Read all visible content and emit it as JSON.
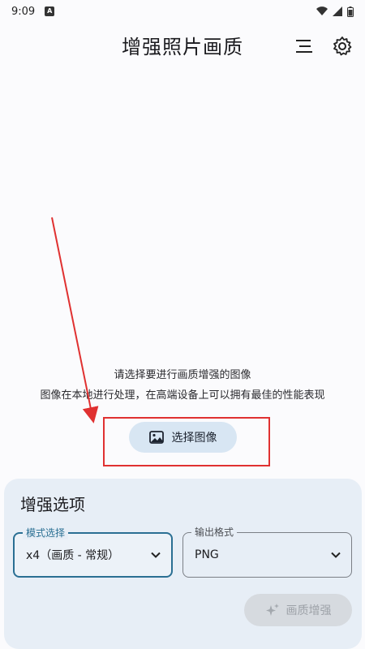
{
  "status_bar": {
    "time": "9:09",
    "notification_badge": "A",
    "icons": [
      "wifi-icon",
      "signal-icon",
      "battery-icon"
    ]
  },
  "app_bar": {
    "title": "增强照片画质",
    "icons": [
      "menu-lines-icon",
      "gear-icon"
    ]
  },
  "main": {
    "prompt_line_1": "请选择要进行画质增强的图像",
    "prompt_line_2": "图像在本地进行处理，在高端设备上可以拥有最佳的性能表现",
    "select_image_label": "选择图像",
    "select_image_icon": "image-icon"
  },
  "options": {
    "title": "增强选项",
    "mode": {
      "label": "模式选择",
      "value": "x4（画质 - 常规）"
    },
    "format": {
      "label": "输出格式",
      "value": "PNG"
    },
    "enhance_button": {
      "label": "画质增强",
      "icon": "sparkle-icon",
      "enabled": false
    }
  },
  "colors": {
    "accent": "#2a6f93",
    "annotation": "#e03131",
    "panel_bg": "#e7eef6",
    "button_bg": "#d8e6f3"
  }
}
